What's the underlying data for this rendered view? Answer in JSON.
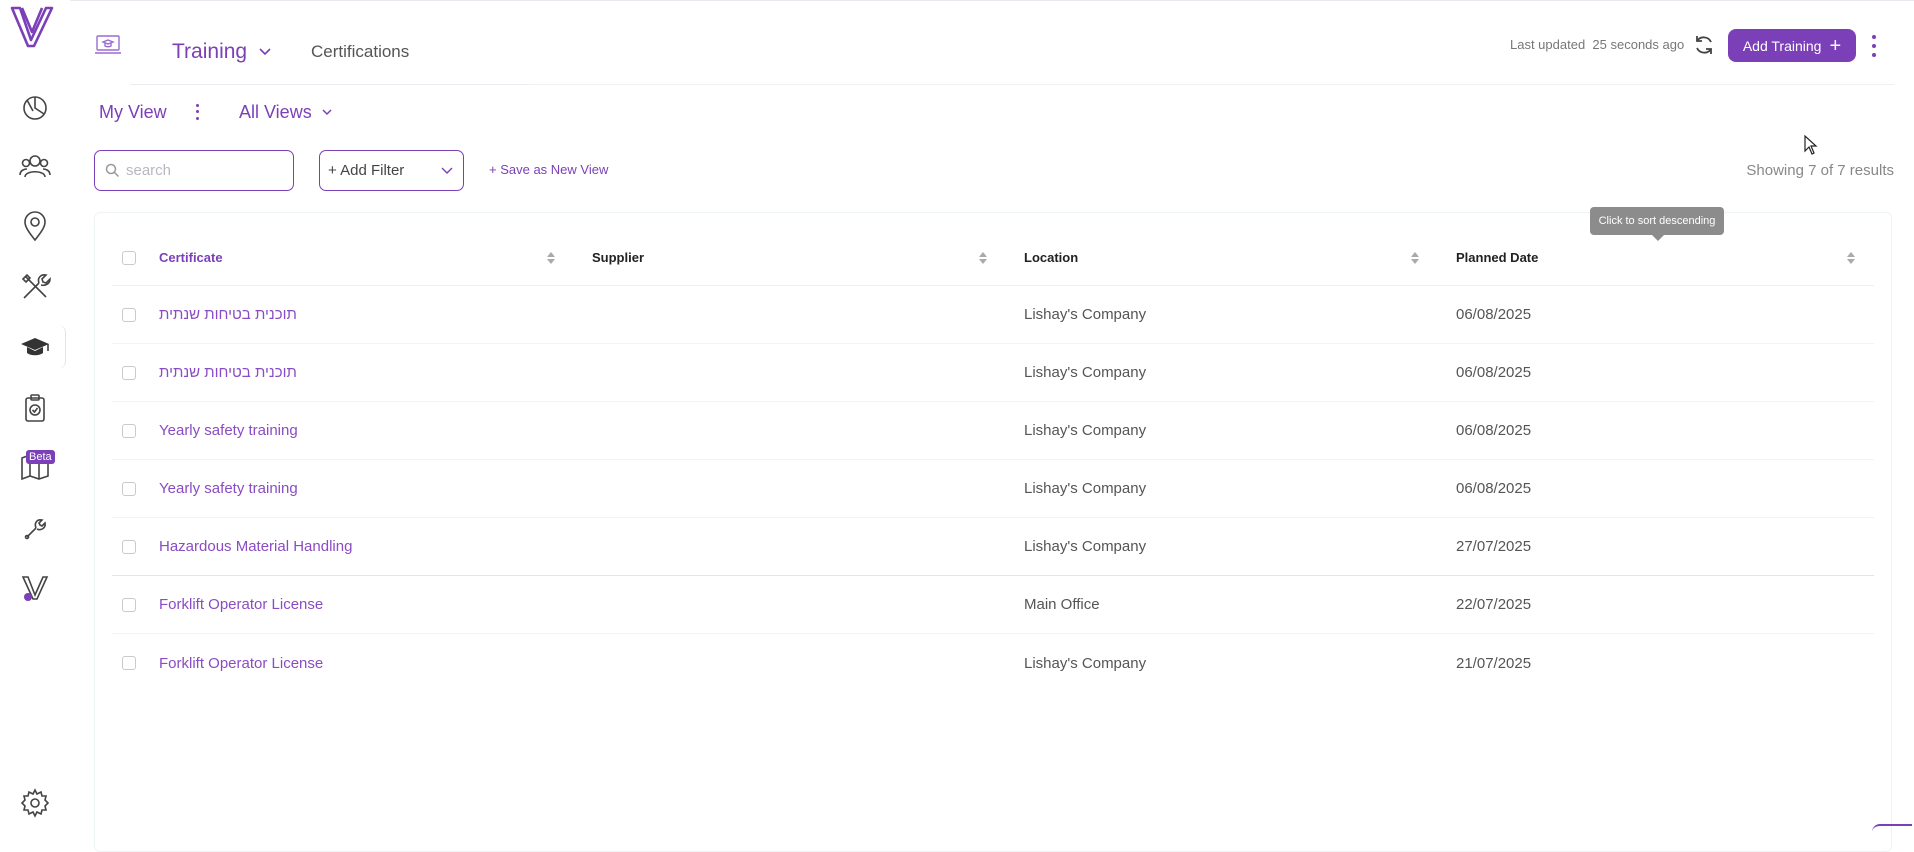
{
  "header": {
    "tab_training": "Training",
    "tab_certifications": "Certifications",
    "last_updated_label": "Last updated",
    "last_updated_value": "25 seconds ago",
    "add_button": "Add Training",
    "add_button_plus": "+"
  },
  "views": {
    "my_view": "My View",
    "all_views": "All Views"
  },
  "filters": {
    "search_placeholder": "search",
    "add_filter": "+ Add Filter",
    "save_view": "+ Save as New View",
    "showing": "Showing 7 of 7 results"
  },
  "sidebar": {
    "beta": "Beta",
    "items": [
      "dashboard-icon",
      "people-icon",
      "location-pin-icon",
      "tools-icon",
      "graduation-cap-icon",
      "clipboard-check-icon",
      "map-icon",
      "wrench-icon",
      "brand-icon",
      "gear-icon"
    ]
  },
  "table": {
    "columns": [
      "Certificate",
      "Supplier",
      "Location",
      "Planned Date"
    ],
    "tooltip": "Click to sort descending",
    "rows": [
      {
        "certificate": "תוכנית בטיחות שנתית",
        "supplier": "",
        "location": "Lishay's Company",
        "date": "06/08/2025"
      },
      {
        "certificate": "תוכנית בטיחות שנתית",
        "supplier": "",
        "location": "Lishay's Company",
        "date": "06/08/2025"
      },
      {
        "certificate": "Yearly safety training",
        "supplier": "",
        "location": "Lishay's Company",
        "date": "06/08/2025"
      },
      {
        "certificate": "Yearly safety training",
        "supplier": "",
        "location": "Lishay's Company",
        "date": "06/08/2025"
      },
      {
        "certificate": "Hazardous Material Handling",
        "supplier": "",
        "location": "Lishay's Company",
        "date": "27/07/2025"
      },
      {
        "certificate": "Forklift Operator License",
        "supplier": "",
        "location": "Main Office",
        "date": "22/07/2025"
      },
      {
        "certificate": "Forklift Operator License",
        "supplier": "",
        "location": "Lishay's Company",
        "date": "21/07/2025"
      }
    ]
  },
  "colors": {
    "accent": "#7b3fb8",
    "link": "#8a4cc4"
  }
}
